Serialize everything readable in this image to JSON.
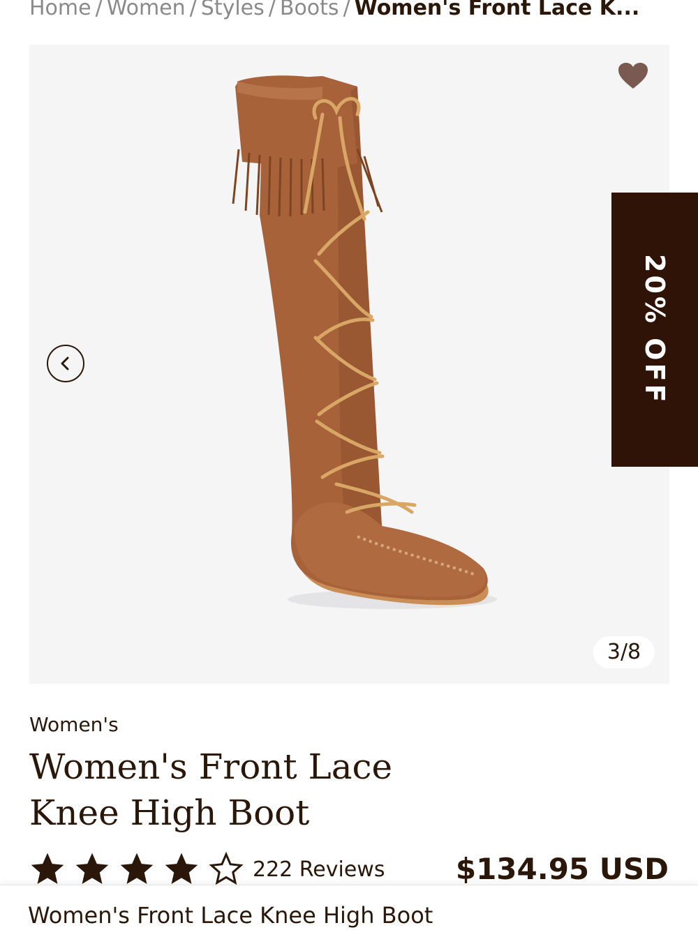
{
  "breadcrumb": {
    "items": [
      "Home",
      "Women",
      "Styles",
      "Boots"
    ],
    "separator": "/",
    "current": "Women's Front Lace K..."
  },
  "gallery": {
    "counter": "3/8",
    "wishlist_icon": "heart-icon",
    "prev_icon": "chevron-left-icon"
  },
  "badge": {
    "discount": "20% OFF"
  },
  "product": {
    "category": "Women's",
    "title": "Women's Front Lace Knee High Boot",
    "rating_value": 4,
    "rating_max": 5,
    "reviews": "222 Reviews",
    "price": "$134.95 USD"
  },
  "sticky_bar": {
    "title": "Women's Front Lace Knee High Boot"
  },
  "colors": {
    "accent_dark": "#2e1306",
    "text": "#2a1709",
    "suede": "#a8623a",
    "heart": "#7a5a50"
  }
}
